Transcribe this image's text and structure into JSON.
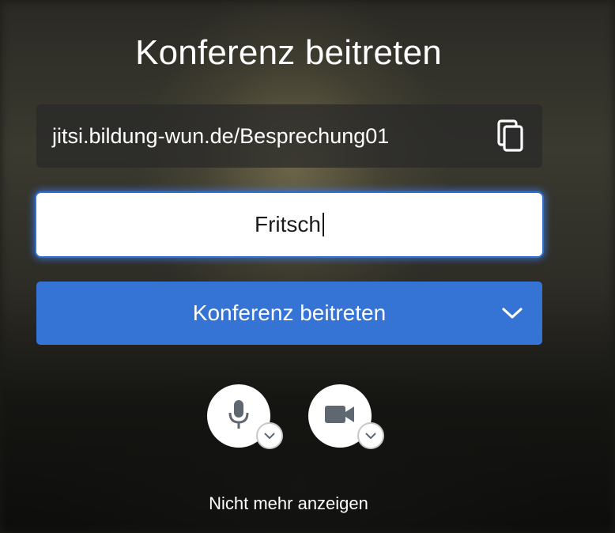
{
  "prejoin": {
    "title": "Konferenz beitreten",
    "meeting_url": "jitsi.bildung-wun.de/Besprechung01",
    "copy_icon": "copy-icon",
    "name_value": "Fritsch",
    "join_label": "Konferenz beitreten",
    "join_options_icon": "chevron-down-icon",
    "mic_icon": "microphone-icon",
    "camera_icon": "camera-icon",
    "options_icon": "chevron-down-icon",
    "dont_show_again": "Nicht mehr anzeigen"
  },
  "colors": {
    "accent": "#3574d4",
    "focus_glow": "#2f6fd0",
    "icon_gray": "#5f6770"
  }
}
